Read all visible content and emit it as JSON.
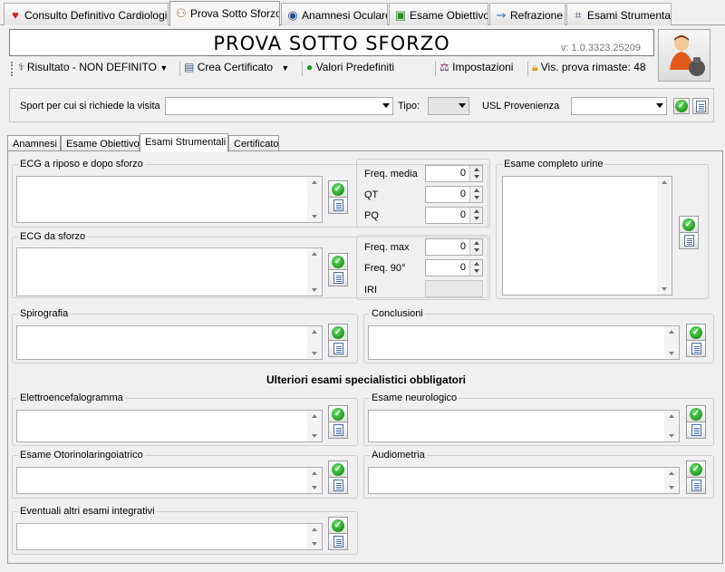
{
  "top_tabs": [
    {
      "label": "Consulto Definitivo Cardiologico",
      "icon": "heart-icon"
    },
    {
      "label": "Prova Sotto Sforzo",
      "icon": "runner-icon"
    },
    {
      "label": "Anamnesi Oculare",
      "icon": "eye-icon"
    },
    {
      "label": "Esame Obiettivo",
      "icon": "examination-icon"
    },
    {
      "label": "Refrazione",
      "icon": "refraction-icon"
    },
    {
      "label": "Esami Strumentali",
      "icon": "instrument-icon"
    }
  ],
  "header": {
    "title": "PROVA SOTTO SFORZO",
    "version": "v: 1.0.3323.25209"
  },
  "toolbar": {
    "result": "Risultato - NON DEFINITO",
    "certificate": "Crea Certificato",
    "defaults": "Valori Predefiniti",
    "settings": "Impostazioni",
    "remaining": "Vis. prova rimaste: 48"
  },
  "sport_bar": {
    "sport_label": "Sport per cui si richiede la visita",
    "sport_value": "",
    "type_label": "Tipo:",
    "type_value": "",
    "usl_label": "USL Provenienza",
    "usl_value": ""
  },
  "inner_tabs": [
    "Anamnesi",
    "Esame Obiettivo",
    "Esami Strumentali",
    "Certificato"
  ],
  "groups": {
    "ecg_rest": "ECG a riposo e dopo sforzo",
    "ecg_stress": "ECG da sforzo",
    "urine": "Esame completo urine",
    "spiro": "Spirografia",
    "conclusioni": "Conclusioni",
    "further": "Ulteriori esami specialistici obbligatori",
    "eeg": "Elettroencefalogramma",
    "neuro": "Esame neurologico",
    "oto": "Esame Otorinolaringoiatrico",
    "audio": "Audiometria",
    "altri": "Eventuali altri esami integrativi"
  },
  "ecg_rest_fields": [
    {
      "label": "Freq. media",
      "value": "0"
    },
    {
      "label": "QT",
      "value": "0"
    },
    {
      "label": "PQ",
      "value": "0"
    }
  ],
  "ecg_stress_fields": [
    {
      "label": "Freq. max",
      "value": "0"
    },
    {
      "label": "Freq. 90°",
      "value": "0"
    },
    {
      "label": "IRI",
      "value": ""
    }
  ]
}
